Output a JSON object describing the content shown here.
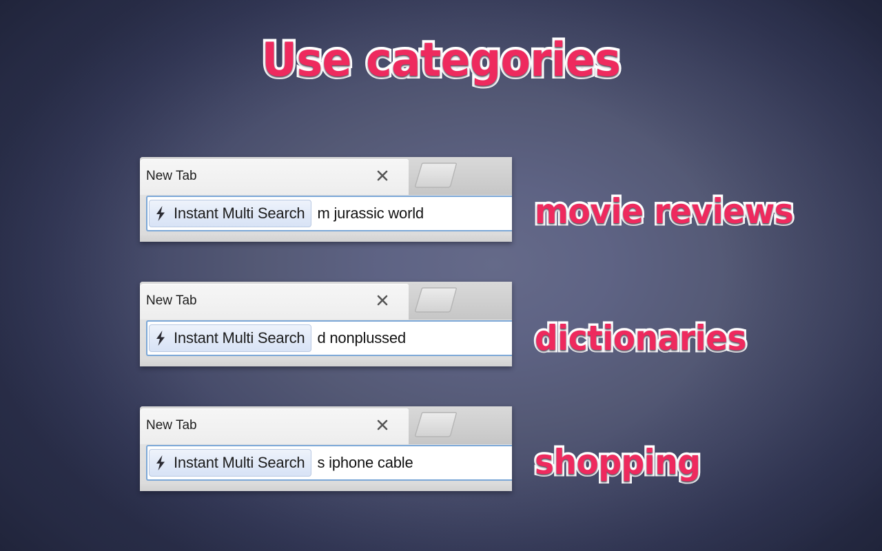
{
  "headline": "Use categories",
  "colors": {
    "accent_pink": "#ee2a5e",
    "outline_white": "#ffffff",
    "background_dark": "#2e3350",
    "background_light": "#656a89",
    "omnibox_focus_blue": "#7ba7d7"
  },
  "widgets": [
    {
      "tab_title": "New Tab",
      "close_icon": "close-icon",
      "new_tab_icon": "new-tab-button-icon",
      "keyword_chip": {
        "icon": "lightning-bolt-icon",
        "label": "Instant Multi Search"
      },
      "omnibox_query": "m jurassic world",
      "annotation": "movie reviews"
    },
    {
      "tab_title": "New Tab",
      "close_icon": "close-icon",
      "new_tab_icon": "new-tab-button-icon",
      "keyword_chip": {
        "icon": "lightning-bolt-icon",
        "label": "Instant Multi Search"
      },
      "omnibox_query": "d nonplussed",
      "annotation": "dictionaries"
    },
    {
      "tab_title": "New Tab",
      "close_icon": "close-icon",
      "new_tab_icon": "new-tab-button-icon",
      "keyword_chip": {
        "icon": "lightning-bolt-icon",
        "label": "Instant Multi Search"
      },
      "omnibox_query": "s iphone cable",
      "annotation": "shopping"
    }
  ]
}
